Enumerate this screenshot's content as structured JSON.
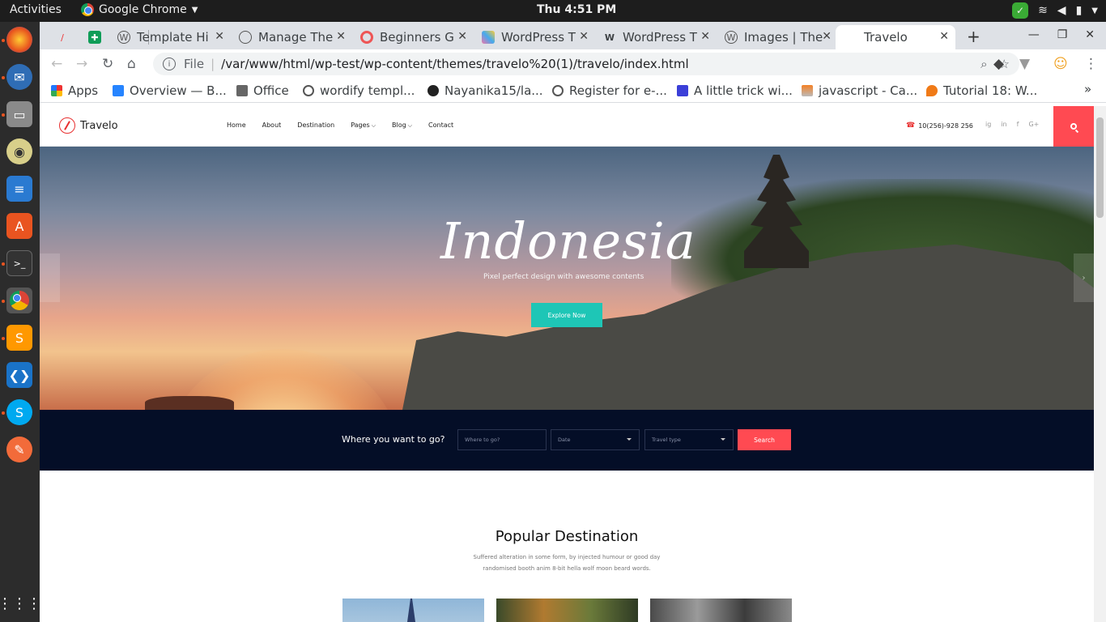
{
  "os": {
    "activities": "Activities",
    "app_name": "Google Chrome",
    "clock": "Thu  4:51 PM"
  },
  "browser": {
    "tabs": [
      {
        "label": ""
      },
      {
        "label": ""
      },
      {
        "label": "Template Hi"
      },
      {
        "label": "Manage The"
      },
      {
        "label": "Beginners G"
      },
      {
        "label": "WordPress T"
      },
      {
        "label": "WordPress T"
      },
      {
        "label": "Images | The"
      },
      {
        "label": "Travelo"
      }
    ],
    "url_scheme": "File",
    "url": "/var/www/html/wp-test/wp-content/themes/travelo%20(1)/travelo/index.html",
    "bookmarks": [
      {
        "label": "Apps"
      },
      {
        "label": "Overview — B..."
      },
      {
        "label": "Office"
      },
      {
        "label": "wordify templ..."
      },
      {
        "label": "Nayanika15/la..."
      },
      {
        "label": "Register for e-..."
      },
      {
        "label": "A little trick wi..."
      },
      {
        "label": "javascript - Ca..."
      },
      {
        "label": "Tutorial 18: W..."
      }
    ]
  },
  "site": {
    "logo": "Travelo",
    "nav": [
      "Home",
      "About",
      "Destination",
      "Pages",
      "Blog",
      "Contact"
    ],
    "phone": "10(256)-928 256",
    "socials": [
      "ig",
      "in",
      "f",
      "G+"
    ],
    "hero": {
      "title": "Indonesia",
      "subtitle": "Pixel perfect design with awesome contents",
      "cta": "Explore Now"
    },
    "search": {
      "label": "Where you want to go?",
      "where_placeholder": "Where to go?",
      "date": "Date",
      "type": "Travel type",
      "button": "Search"
    },
    "popular": {
      "title": "Popular Destination",
      "line1": "Suffered alteration in some form, by injected humour or good day",
      "line2": "randomised booth anim 8-bit hella wolf moon beard words."
    }
  },
  "colors": {
    "accent_red": "#ff4a52",
    "teal": "#1ec6b6",
    "navy": "#040e27"
  }
}
